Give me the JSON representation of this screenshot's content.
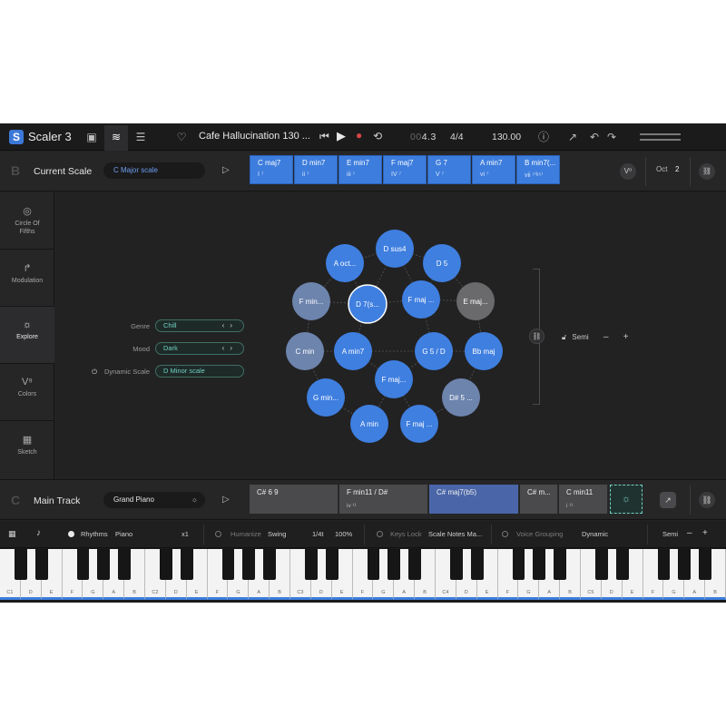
{
  "app": {
    "title": "Scaler 3",
    "logo_letter": "S"
  },
  "topbar": {
    "song_title": "Cafe Hallucination 130 ...",
    "position_dim": "00",
    "position": "4.3",
    "time_signature": "4/4",
    "bpm": "130.00"
  },
  "scale_bar": {
    "letter": "B",
    "title": "Current Scale",
    "scale_name": "C Major scale",
    "chords": [
      {
        "name": "C maj7",
        "degree": "I ⁷"
      },
      {
        "name": "D min7",
        "degree": "ii ⁷"
      },
      {
        "name": "E min7",
        "degree": "iii ⁷"
      },
      {
        "name": "F maj7",
        "degree": "IV ⁷"
      },
      {
        "name": "G 7",
        "degree": "V ⁷"
      },
      {
        "name": "A min7",
        "degree": "vi ⁷"
      },
      {
        "name": "B min7(...",
        "degree": "vii ⁷⁽ᵇ⁵⁾"
      }
    ],
    "voicing_badge": "V⁰",
    "oct_label": "Oct",
    "oct_value": "2"
  },
  "sidebar": {
    "items": [
      {
        "label": "Circle Of Fifths",
        "icon": "target-icon"
      },
      {
        "label": "Modulation",
        "icon": "modulation-arrow-icon"
      },
      {
        "label": "Explore",
        "icon": "lightbulb-icon"
      },
      {
        "label": "Colors",
        "icon": "voicing-icon"
      },
      {
        "label": "Sketch",
        "icon": "grid-icon"
      }
    ]
  },
  "explore": {
    "genre_label": "Genre",
    "genre_value": "Chill",
    "mood_label": "Mood",
    "mood_value": "Dark",
    "dynamic_scale_label": "Dynamic Scale",
    "dynamic_scale_value": "D Minor scale",
    "semi_label": "Semi",
    "minus": "–",
    "plus": "+",
    "nodes": [
      {
        "label": "D sus4",
        "color": "#3f7fe0"
      },
      {
        "label": "A oct...",
        "color": "#3f7fe0"
      },
      {
        "label": "D 5",
        "color": "#3f7fe0"
      },
      {
        "label": "F min...",
        "color": "#6d84ad"
      },
      {
        "label": "D 7(s...",
        "color": "#3f7fe0"
      },
      {
        "label": "F maj ...",
        "color": "#3f7fe0"
      },
      {
        "label": "E maj...",
        "color": "#6a6a6c"
      },
      {
        "label": "C min",
        "color": "#6d84ad"
      },
      {
        "label": "A min7",
        "color": "#3f7fe0"
      },
      {
        "label": "G 5 / D",
        "color": "#3f7fe0"
      },
      {
        "label": "Bb maj",
        "color": "#3f7fe0"
      },
      {
        "label": "F maj...",
        "color": "#3f7fe0"
      },
      {
        "label": "G min...",
        "color": "#3f7fe0"
      },
      {
        "label": "D# 5 ...",
        "color": "#6d84ad"
      },
      {
        "label": "A min",
        "color": "#3f7fe0"
      },
      {
        "label": "F maj ...",
        "color": "#3f7fe0"
      }
    ]
  },
  "track_bar": {
    "letter": "C",
    "title": "Main Track",
    "instrument": "Grand Piano",
    "chords": [
      {
        "name": "C# 6 9",
        "degree": ""
      },
      {
        "name": "F min11 / D#",
        "degree": "iv ¹¹"
      },
      {
        "name": "C# maj7(b5)",
        "degree": ""
      },
      {
        "name": "C# m...",
        "degree": ""
      },
      {
        "name": "C min11",
        "degree": "i ¹¹"
      }
    ]
  },
  "options_bar": {
    "rhythms_label": "Rhythms",
    "rhythms_value": "Piano",
    "multiplier": "x1",
    "humanize_label": "Humanize",
    "swing_label": "Swing",
    "note_value": "1/4t",
    "percent": "100%",
    "keys_lock_label": "Keys Lock",
    "keys_lock_value": "Scale Notes Ma...",
    "voice_grouping_label": "Voice Grouping",
    "voice_grouping_value": "Dynamic",
    "semi_label": "Semi",
    "minus": "–",
    "plus": "+"
  },
  "keyboard": {
    "white_keys": [
      "C1",
      "D",
      "E",
      "F",
      "G",
      "A",
      "B",
      "C2",
      "D",
      "E",
      "F",
      "G",
      "A",
      "B",
      "C3",
      "D",
      "E",
      "F",
      "G",
      "A",
      "B",
      "C4",
      "D",
      "E",
      "F",
      "G",
      "A",
      "B",
      "C5",
      "D",
      "E",
      "F",
      "G",
      "A",
      "B"
    ]
  },
  "colors": {
    "accent_blue": "#3d7ddd",
    "teal": "#6fd0c0",
    "background": "#232324"
  }
}
